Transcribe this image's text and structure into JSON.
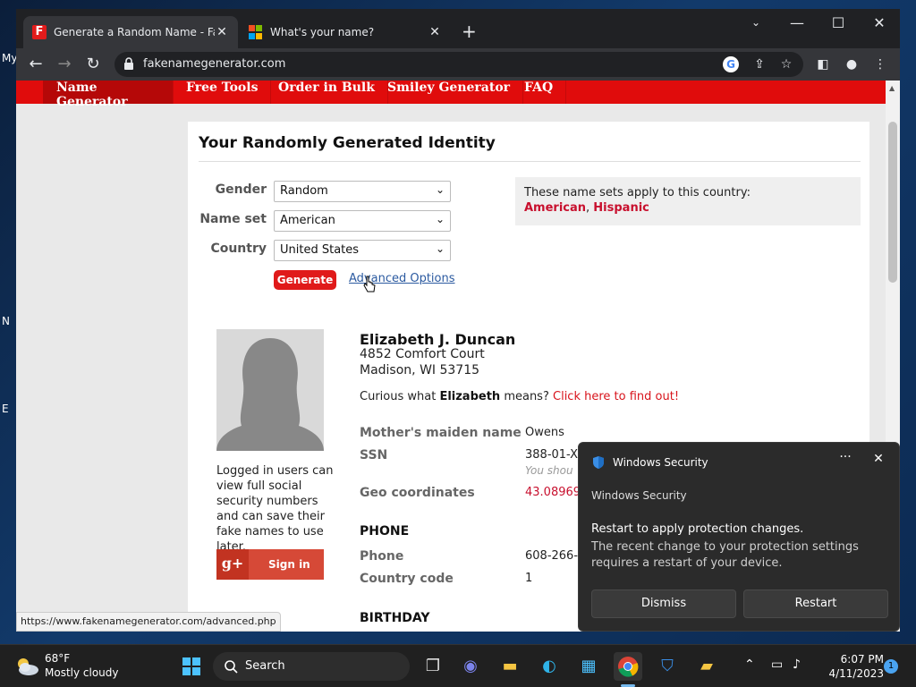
{
  "browser": {
    "tabs": [
      {
        "title": "Generate a Random Name - Fake",
        "close": "✕"
      },
      {
        "title": "What's your name?",
        "close": "✕"
      }
    ],
    "new_tab": "+",
    "url": "fakenamegenerator.com"
  },
  "site": {
    "nav": [
      "Name Generator",
      "Free Tools",
      "Order in Bulk",
      "Smiley Generator",
      "FAQ"
    ],
    "heading": "Your Randomly Generated Identity",
    "form": {
      "gender_label": "Gender",
      "gender_value": "Random",
      "nameset_label": "Name set",
      "nameset_value": "American",
      "country_label": "Country",
      "country_value": "United States",
      "generate": "Generate",
      "advanced": "Advanced Options"
    },
    "namesets": {
      "intro": "These name sets apply to this country:",
      "first": "American",
      "sep": ", ",
      "second": "Hispanic"
    },
    "login_text": "Logged in users can view full social security numbers and can save their fake names to use later.",
    "signin": {
      "icon": "g+",
      "label": "Sign in"
    },
    "identity": {
      "name": "Elizabeth J. Duncan",
      "address1": "4852 Comfort Court",
      "address2": "Madison, WI 53715",
      "curious_pre": "Curious what ",
      "curious_name": "Elizabeth",
      "curious_mid": " means? ",
      "curious_link": "Click here to find out!",
      "fields": {
        "maiden_label": "Mother's maiden name",
        "maiden_value": "Owens",
        "ssn_label": "SSN",
        "ssn_value": "388-01-X",
        "ssn_note": "You shou",
        "geo_label": "Geo coordinates",
        "geo_value": "43.08969"
      },
      "phone_section": "PHONE",
      "phone_label": "Phone",
      "phone_value": "608-266-",
      "cc_label": "Country code",
      "cc_value": "1",
      "birthday_section": "BIRTHDAY"
    },
    "status_url": "https://www.fakenamegenerator.com/advanced.php"
  },
  "toast": {
    "app": "Windows Security",
    "source": "Windows Security",
    "title": "Restart to apply protection changes.",
    "body": "The recent change to your protection settings requires a restart of your device.",
    "dismiss": "Dismiss",
    "restart": "Restart",
    "more": "···",
    "close": "✕"
  },
  "taskbar": {
    "temp": "68°F",
    "condition": "Mostly cloudy",
    "search": "Search",
    "time": "6:07 PM",
    "date": "4/11/2023",
    "notifications": "1"
  },
  "desktop_labels": [
    "My",
    "N",
    "E"
  ]
}
